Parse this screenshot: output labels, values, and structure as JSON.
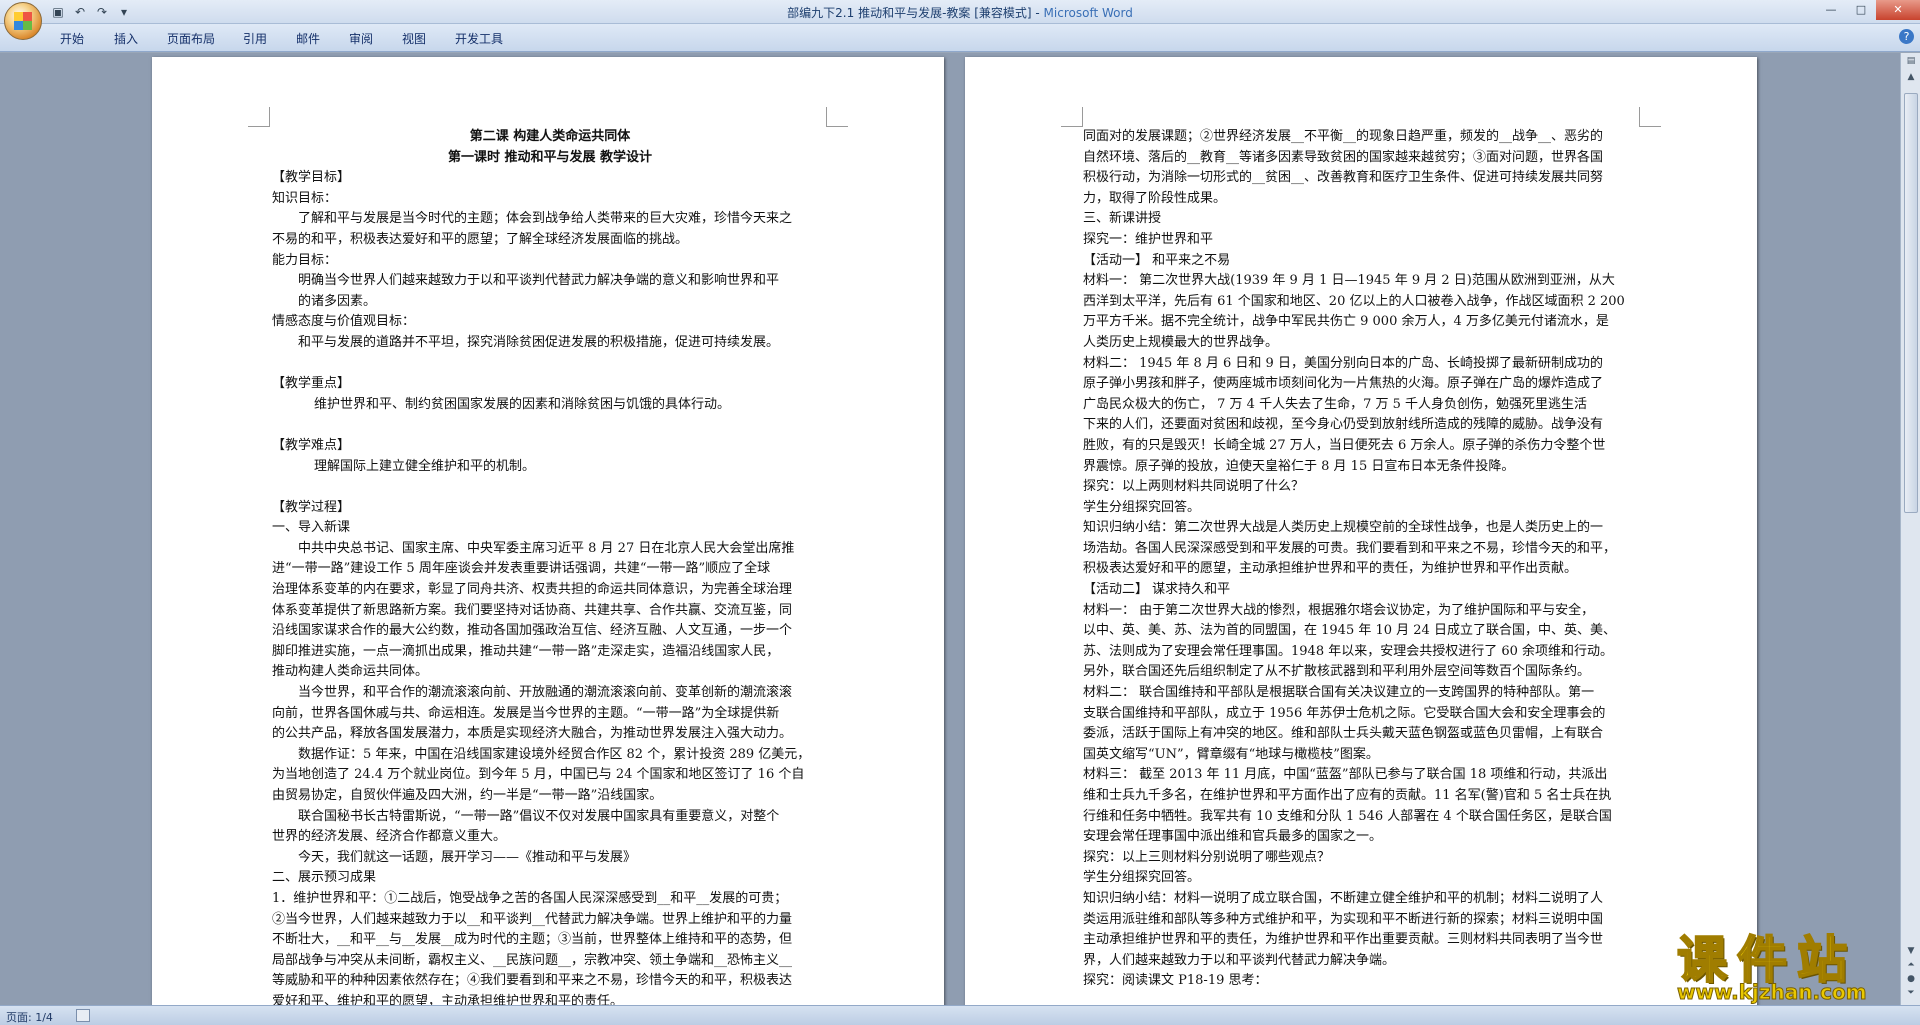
{
  "window": {
    "title": "部编九下2.1 推动和平与发展-教案 [兼容模式] - ",
    "app_name": "Microsoft Word"
  },
  "ribbon": {
    "tabs": [
      "开始",
      "插入",
      "页面布局",
      "引用",
      "邮件",
      "审阅",
      "视图",
      "开发工具"
    ]
  },
  "status": {
    "page": "页面: 1/4"
  },
  "watermark": {
    "logo_text": "课件站",
    "url": "www.kjzhan.com"
  },
  "page1": {
    "title1": "第二课  构建人类命运共同体",
    "title2": "第一课时  推动和平与发展  教学设计",
    "lines": [
      "【教学目标】",
      "知识目标：",
      "了解和平与发展是当今时代的主题；体会到战争给人类带来的巨大灾难，珍惜今天来之",
      "不易的和平，积极表达爱好和平的愿望；了解全球经济发展面临的挑战。",
      "能力目标：",
      "明确当今世界人们越来越致力于以和平谈判代替武力解决争端的意义和影响世界和平",
      "的诸多因素。",
      "情感态度与价值观目标：",
      "和平与发展的道路并不平坦，探究消除贫困促进发展的积极措施，促进可持续发展。",
      "",
      "【教学重点】",
      "维护世界和平、制约贫困国家发展的因素和消除贫困与饥饿的具体行动。",
      "",
      "【教学难点】",
      "理解国际上建立健全维护和平的机制。",
      "",
      "【教学过程】",
      "一、导入新课",
      "中共中央总书记、国家主席、中央军委主席习近平 8 月 27 日在北京人民大会堂出席推",
      "进“一带一路”建设工作 5 周年座谈会并发表重要讲话强调，共建“一带一路”顺应了全球",
      "治理体系变革的内在要求，彰显了同舟共济、权责共担的命运共同体意识，为完善全球治理",
      "体系变革提供了新思路新方案。我们要坚持对话协商、共建共享、合作共赢、交流互鉴，同",
      "沿线国家谋求合作的最大公约数，推动各国加强政治互信、经济互融、人文互通，一步一个",
      "脚印推进实施，一点一滴抓出成果，推动共建“一带一路”走深走实，造福沿线国家人民，",
      "推动构建人类命运共同体。",
      "当今世界，和平合作的潮流滚滚向前、开放融通的潮流滚滚向前、变革创新的潮流滚滚",
      "向前，世界各国休戚与共、命运相连。发展是当今世界的主题。“一带一路”为全球提供新",
      "的公共产品，释放各国发展潜力，本质是实现经济大融合，为推动世界发展注入强大动力。",
      "数据作证：5 年来，中国在沿线国家建设境外经贸合作区 82 个，累计投资 289 亿美元，",
      "为当地创造了 24.4 万个就业岗位。到今年 5 月，中国已与 24 个国家和地区签订了 16 个自",
      "由贸易协定，自贸伙伴遍及四大洲，约一半是“一带一路”沿线国家。",
      "联合国秘书长古特雷斯说，“一带一路”倡议不仅对发展中国家具有重要意义，对整个",
      "世界的经济发展、经济合作都意义重大。",
      "今天，我们就这一话题，展开学习——《推动和平与发展》",
      "二、展示预习成果",
      "1．维护世界和平：①二战后，饱受战争之苦的各国人民深深感受到__和平__发展的可贵；",
      "②当今世界，人们越来越致力于以__和平谈判__代替武力解决争端。世界上维护和平的力量",
      "不断壮大，__和平__与__发展__成为时代的主题；③当前，世界整体上维持和平的态势，但",
      "局部战争与冲突从未间断，霸权主义、__民族问题__，宗教冲突、领土争端和__恐怖主义__",
      "等威胁和平的种种因素依然存在；④我们要看到和平来之不易，珍惜今天的和平，积极表达",
      "爱好和平、维护和平的愿望，主动承担维护世界和平的责任。"
    ]
  },
  "page2": {
    "lines": [
      "同面对的发展课题；②世界经济发展__不平衡__的现象日趋严重，频发的__战争__、恶劣的",
      "自然环境、落后的__教育__等诸多因素导致贫困的国家越来越贫穷；③面对问题，世界各国",
      "积极行动，为消除一切形式的__贫困__、改善教育和医疗卫生条件、促进可持续发展共同努",
      "力，取得了阶段性成果。",
      "三、新课讲授",
      "探究一：维护世界和平",
      "【活动一】  和平来之不易",
      "材料一：  第二次世界大战(1939 年 9 月 1 日—1945 年 9 月 2 日)范围从欧洲到亚洲，从大",
      "西洋到太平洋，先后有 61 个国家和地区、20 亿以上的人口被卷入战争，作战区域面积 2 200",
      "万平方千米。据不完全统计，战争中军民共伤亡 9 000 余万人，4 万多亿美元付诸流水，是",
      "人类历史上规模最大的世界战争。",
      "材料二：  1945 年 8 月 6 日和 9 日，美国分别向日本的广岛、长崎投掷了最新研制成功的",
      "原子弹小男孩和胖子，使两座城市顷刻间化为一片焦热的火海。原子弹在广岛的爆炸造成了",
      "广岛民众极大的伤亡，  7  万  4  千人失去了生命，7  万  5  千人身负创伤，勉强死里逃生活",
      "下来的人们，还要面对贫困和歧视，至今身心仍受到放射线所造成的残障的威胁。战争没有",
      "胜败，有的只是毁灭！长崎全城 27 万人，当日便死去 6 万余人。原子弹的杀伤力令整个世",
      "界震惊。原子弹的投放，迫使天皇裕仁于 8 月 15 日宣布日本无条件投降。",
      "探究：以上两则材料共同说明了什么？",
      "学生分组探究回答。",
      "知识归纳小结：第二次世界大战是人类历史上规模空前的全球性战争，也是人类历史上的一",
      "场浩劫。各国人民深深感受到和平发展的可贵。我们要看到和平来之不易，珍惜今天的和平，",
      "积极表达爱好和平的愿望，主动承担维护世界和平的责任，为维护世界和平作出贡献。",
      "【活动二】  谋求持久和平",
      "材料一：  由于第二次世界大战的惨烈，根据雅尔塔会议协定，为了维护国际和平与安全，",
      "以中、英、美、苏、法为首的同盟国，在 1945 年 10 月 24 日成立了联合国，中、英、美、",
      "苏、法则成为了安理会常任理事国。1948 年以来，安理会共授权进行了 60 余项维和行动。",
      "另外，联合国还先后组织制定了从不扩散核武器到和平利用外层空间等数百个国际条约。",
      "材料二：  联合国维持和平部队是根据联合国有关决议建立的一支跨国界的特种部队。第一",
      "支联合国维持和平部队，成立于 1956 年苏伊士危机之际。它受联合国大会和安全理事会的",
      "委派，活跃于国际上有冲突的地区。维和部队士兵头戴天蓝色钢盔或蓝色贝雷帽，上有联合",
      "国英文缩写“UN”，臂章缀有“地球与橄榄枝”图案。",
      "材料三：  截至 2013 年 11 月底，中国“蓝盔”部队已参与了联合国 18 项维和行动，共派出",
      "维和士兵九千多名，在维护世界和平方面作出了应有的贡献。11 名军(警)官和 5 名士兵在执",
      "行维和任务中牺牲。我军共有 10 支维和分队 1  546 人部署在 4 个联合国任务区，是联合国",
      "安理会常任理事国中派出维和官兵最多的国家之一。",
      "探究：以上三则材料分别说明了哪些观点？",
      "学生分组探究回答。",
      "知识归纳小结：材料一说明了成立联合国，不断建立健全维护和平的机制；材料二说明了人",
      "类运用派驻维和部队等多种方式维护和平，为实现和平不断进行新的探索；材料三说明中国",
      "主动承担维护世界和平的责任，为维护世界和平作出重要贡献。三则材料共同表明了当今世",
      "界，人们越来越致力于以和平谈判代替武力解决争端。",
      "探究：阅读课文 P18-19 思考："
    ]
  }
}
